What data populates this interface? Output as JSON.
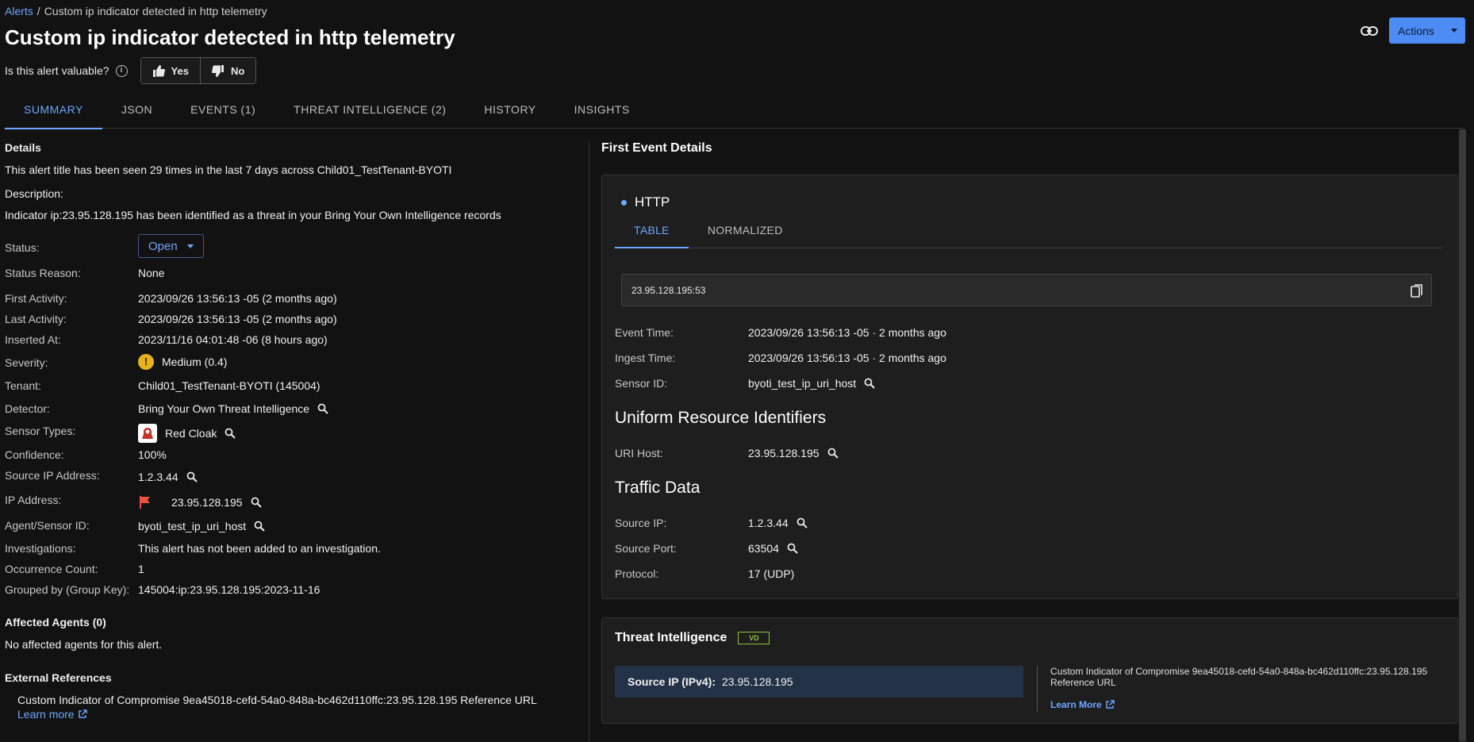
{
  "breadcrumb": {
    "root": "Alerts",
    "separator": "/",
    "current": "Custom ip indicator detected in http telemetry"
  },
  "title": "Custom ip indicator detected in http telemetry",
  "feedback": {
    "question": "Is this alert valuable?",
    "yes": "Yes",
    "no": "No"
  },
  "header_actions": {
    "actions_label": "Actions"
  },
  "tabs": [
    "SUMMARY",
    "JSON",
    "EVENTS (1)",
    "THREAT INTELLIGENCE (2)",
    "HISTORY",
    "INSIGHTS"
  ],
  "details": {
    "title": "Details",
    "seen_text": "This alert title has been seen 29 times in the last 7 days across Child01_TestTenant-BYOTI",
    "description_label": "Description:",
    "description": "Indicator ip:23.95.128.195 has been identified as a threat in your Bring Your Own Intelligence records",
    "status_label": "Status:",
    "status": "Open",
    "status_reason_label": "Status Reason:",
    "status_reason": "None",
    "first_activity_label": "First Activity:",
    "first_activity": "2023/09/26 13:56:13 -05 (2 months ago)",
    "last_activity_label": "Last Activity:",
    "last_activity": "2023/09/26 13:56:13 -05 (2 months ago)",
    "inserted_at_label": "Inserted At:",
    "inserted_at": "2023/11/16 04:01:48 -06 (8 hours ago)",
    "severity_label": "Severity:",
    "severity": "Medium (0.4)",
    "tenant_label": "Tenant:",
    "tenant": "Child01_TestTenant-BYOTI (145004)",
    "detector_label": "Detector:",
    "detector": "Bring Your Own Threat Intelligence",
    "sensor_types_label": "Sensor Types:",
    "sensor_type": "Red Cloak",
    "confidence_label": "Confidence:",
    "confidence": "100%",
    "source_ip_label": "Source IP Address:",
    "source_ip": "1.2.3.44",
    "ip_address_label": "IP Address:",
    "ip_address": "23.95.128.195",
    "agent_sensor_label": "Agent/Sensor ID:",
    "agent_sensor": "byoti_test_ip_uri_host",
    "investigations_label": "Investigations:",
    "investigations": "This alert has not been added to an investigation.",
    "occurrence_label": "Occurrence Count:",
    "occurrence": "1",
    "group_key_label": "Grouped by (Group Key):",
    "group_key": "145004:ip:23.95.128.195:2023-11-16"
  },
  "affected_agents": {
    "title": "Affected Agents",
    "count": "(0)",
    "empty": "No affected agents for this alert."
  },
  "external_refs": {
    "title": "External References",
    "text": "Custom Indicator of Compromise 9ea45018-cefd-54a0-848a-bc462d110ffc:23.95.128.195 Reference URL",
    "learn_more": "Learn more"
  },
  "first_event": {
    "title": "First Event Details",
    "event_type": "HTTP",
    "subtabs": [
      "TABLE",
      "NORMALIZED"
    ],
    "endpoint": "23.95.128.195:53",
    "event_time_label": "Event Time:",
    "event_time": "2023/09/26 13:56:13 -05 · 2 months ago",
    "ingest_time_label": "Ingest Time:",
    "ingest_time": "2023/09/26 13:56:13 -05 · 2 months ago",
    "sensor_id_label": "Sensor ID:",
    "sensor_id": "byoti_test_ip_uri_host",
    "uri_section": "Uniform Resource Identifiers",
    "uri_host_label": "URI Host:",
    "uri_host": "23.95.128.195",
    "traffic_section": "Traffic Data",
    "source_ip_label": "Source IP:",
    "source_ip": "1.2.3.44",
    "source_port_label": "Source Port:",
    "source_port": "63504",
    "protocol_label": "Protocol:",
    "protocol": "17 (UDP)"
  },
  "threat_intel": {
    "title": "Threat Intelligence",
    "logo_text": "VD",
    "source_ip_label": "Source IP (IPv4):",
    "source_ip": "23.95.128.195",
    "ref_text": "Custom Indicator of Compromise 9ea45018-cefd-54a0-848a-bc462d110ffc:23.95.128.195 Reference URL",
    "learn_more": "Learn More"
  },
  "colors": {
    "accent": "#6ea6ff",
    "button": "#4d8cf5",
    "background": "#121212",
    "card": "#1e1e1e",
    "severity_medium": "#e6b21f",
    "flag": "#e8553b"
  }
}
